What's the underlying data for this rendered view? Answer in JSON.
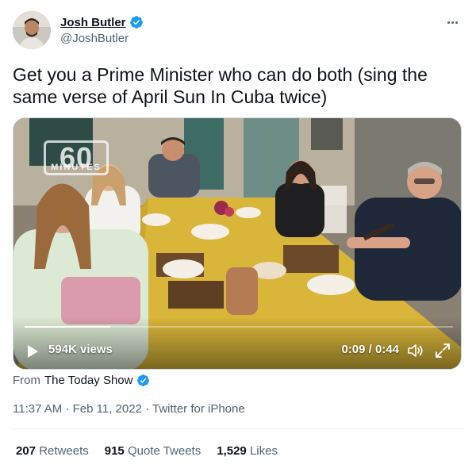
{
  "author": {
    "name": "Josh Butler",
    "handle": "@JoshButler",
    "verified": true
  },
  "more_icon": "more-horizontal-icon",
  "tweet": {
    "text": "Get you a Prime Minister who can do both (sing the same verse of April Sun In Cuba twice)"
  },
  "media": {
    "watermark": "60",
    "watermark_sub": "MINUTES",
    "views": "594K views",
    "time": "0:09 / 0:44",
    "progress": 0.2
  },
  "source": {
    "prefix": "From",
    "name": "The Today Show",
    "verified": true
  },
  "meta": {
    "time": "11:37 AM",
    "sep1": "·",
    "date": "Feb 11, 2022",
    "sep2": "·",
    "client": "Twitter for iPhone"
  },
  "stats": {
    "retweets_count": "207",
    "retweets_label": "Retweets",
    "quotes_count": "915",
    "quotes_label": "Quote Tweets",
    "likes_count": "1,529",
    "likes_label": "Likes"
  },
  "colors": {
    "verified_blue": "#1d9bf0",
    "text_primary": "#0f1419",
    "text_secondary": "#536471",
    "table_yellow": "#d9b63a"
  }
}
